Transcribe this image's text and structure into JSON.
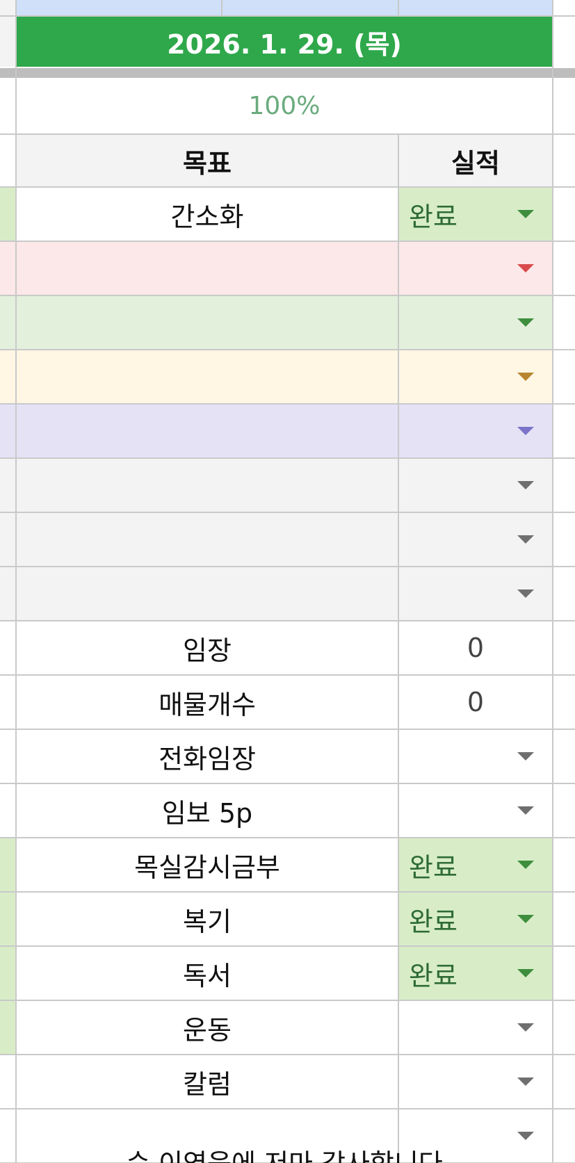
{
  "header": {
    "date": "2026. 1. 29. (목)",
    "completion_percent": "100%",
    "col_goal": "목표",
    "col_result": "실적"
  },
  "rows": [
    {
      "goal": "간소화",
      "result": "완료",
      "fill": "#d8edc7",
      "arrow": "#3e8e3e",
      "row_bg": "#ffffff",
      "left": "#d8edc7"
    },
    {
      "goal": "",
      "result": "",
      "fill": "#fce8e8",
      "arrow": "#d94b4b",
      "row_bg": "#fce8e8",
      "left": "#fce8e8"
    },
    {
      "goal": "",
      "result": "",
      "fill": "#e3f0dc",
      "arrow": "#3e8e3e",
      "row_bg": "#e3f0dc",
      "left": "#e3f0dc"
    },
    {
      "goal": "",
      "result": "",
      "fill": "#fff6e3",
      "arrow": "#b8862e",
      "row_bg": "#fff6e3",
      "left": "#fff6e3"
    },
    {
      "goal": "",
      "result": "",
      "fill": "#e6e2f6",
      "arrow": "#7b74c9",
      "row_bg": "#e6e2f6",
      "left": "#e6e2f6"
    },
    {
      "goal": "",
      "result": "",
      "fill": "#f3f3f3",
      "arrow": "#6f6f6f",
      "row_bg": "#f3f3f3",
      "left": "#f3f3f3"
    },
    {
      "goal": "",
      "result": "",
      "fill": "#f3f3f3",
      "arrow": "#6f6f6f",
      "row_bg": "#f3f3f3",
      "left": "#f3f3f3"
    },
    {
      "goal": "",
      "result": "",
      "fill": "#f3f3f3",
      "arrow": "#6f6f6f",
      "row_bg": "#f3f3f3",
      "left": "#f3f3f3"
    },
    {
      "goal": "임장",
      "result": "0",
      "type": "number",
      "fill": "#ffffff",
      "row_bg": "#ffffff",
      "left": "#ffffff"
    },
    {
      "goal": "매물개수",
      "result": "0",
      "type": "number",
      "fill": "#ffffff",
      "row_bg": "#ffffff",
      "left": "#ffffff"
    },
    {
      "goal": "전화임장",
      "result": "",
      "fill": "#ffffff",
      "arrow": "#6f6f6f",
      "row_bg": "#ffffff",
      "left": "#ffffff"
    },
    {
      "goal": "임보 5p",
      "result": "",
      "fill": "#ffffff",
      "arrow": "#6f6f6f",
      "row_bg": "#ffffff",
      "left": "#ffffff"
    },
    {
      "goal": "목실감시금부",
      "result": "완료",
      "fill": "#d8edc7",
      "arrow": "#3e8e3e",
      "row_bg": "#ffffff",
      "left": "#d8edc7"
    },
    {
      "goal": "복기",
      "result": "완료",
      "fill": "#d8edc7",
      "arrow": "#3e8e3e",
      "row_bg": "#ffffff",
      "left": "#d8edc7"
    },
    {
      "goal": "독서",
      "result": "완료",
      "fill": "#d8edc7",
      "arrow": "#3e8e3e",
      "row_bg": "#ffffff",
      "left": "#d8edc7"
    },
    {
      "goal": "운동",
      "result": "",
      "fill": "#ffffff",
      "arrow": "#6f6f6f",
      "row_bg": "#ffffff",
      "left": "#d8edc7"
    },
    {
      "goal": "칼럼",
      "result": "",
      "fill": "#ffffff",
      "arrow": "#6f6f6f",
      "row_bg": "#ffffff",
      "left": "#ffffff"
    },
    {
      "goal": "",
      "result": "",
      "fill": "#ffffff",
      "arrow": "#6f6f6f",
      "row_bg": "#ffffff",
      "left": "#ffffff"
    }
  ],
  "footer_partial": "순 이영웅에 저마 감사합니다"
}
